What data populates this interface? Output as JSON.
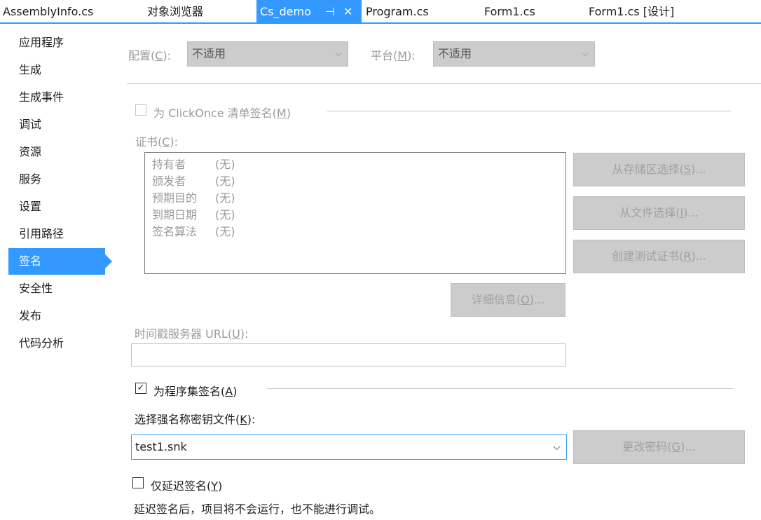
{
  "tabs": [
    {
      "label": "AssemblyInfo.cs"
    },
    {
      "label": "对象浏览器"
    },
    {
      "label": "Cs_demo",
      "pin": "⊣",
      "close": "✕"
    },
    {
      "label": "Program.cs"
    },
    {
      "label": "Form1.cs"
    },
    {
      "label": "Form1.cs [设计]"
    }
  ],
  "sidebar": {
    "items": [
      {
        "label": "应用程序"
      },
      {
        "label": "生成"
      },
      {
        "label": "生成事件"
      },
      {
        "label": "调试"
      },
      {
        "label": "资源"
      },
      {
        "label": "服务"
      },
      {
        "label": "设置"
      },
      {
        "label": "引用路径"
      },
      {
        "label": "签名",
        "active": true
      },
      {
        "label": "安全性"
      },
      {
        "label": "发布"
      },
      {
        "label": "代码分析"
      }
    ]
  },
  "config": {
    "label_pre": "配置(",
    "label_key": "C",
    "label_post": "):",
    "value": "不适用",
    "platform_pre": "平台(",
    "platform_key": "M",
    "platform_post": "):",
    "platform_value": "不适用"
  },
  "clickonce": {
    "checked": false,
    "label_pre": "为 ClickOnce 清单签名(",
    "label_key": "M",
    "label_post": ")"
  },
  "cert": {
    "label_pre": "证书(",
    "label_key": "C",
    "label_post": "):",
    "rows": [
      {
        "key": "持有者",
        "value": "(无)"
      },
      {
        "key": "颁发者",
        "value": "(无)"
      },
      {
        "key": "预期目的",
        "value": "(无)"
      },
      {
        "key": "到期日期",
        "value": "(无)"
      },
      {
        "key": "签名算法",
        "value": "(无)"
      }
    ],
    "btn_store_pre": "从存储区选择(",
    "btn_store_key": "S",
    "btn_store_post": ")...",
    "btn_file_pre": "从文件选择(",
    "btn_file_key": "I",
    "btn_file_post": ")...",
    "btn_test_pre": "创建测试证书(",
    "btn_test_key": "R",
    "btn_test_post": ")...",
    "btn_detail_pre": "详细信息(",
    "btn_detail_key": "O",
    "btn_detail_post": ")..."
  },
  "timestamp": {
    "label_pre": "时间戳服务器 URL(",
    "label_key": "U",
    "label_post": "):",
    "value": ""
  },
  "sign_assembly": {
    "checked": true,
    "check_glyph": "✓",
    "label_pre": "为程序集签名(",
    "label_key": "A",
    "label_post": ")"
  },
  "strong_name": {
    "label_pre": "选择强名称密钥文件(",
    "label_key": "K",
    "label_post": "):",
    "value": "test1.snk",
    "btn_pre": "更改密码(",
    "btn_key": "G",
    "btn_post": ")..."
  },
  "delay_sign": {
    "checked": false,
    "label_pre": "仅延迟签名(",
    "label_key": "Y",
    "label_post": ")",
    "note": "延迟签名后，项目将不会运行，也不能进行调试。"
  },
  "icons": {
    "chevron": "chevron-down-icon",
    "chevron_glyph": "⌵"
  },
  "colors": {
    "accent": "#3399ff",
    "disabled_text": "#9a9a9a",
    "disabled_fill": "#cccccc"
  }
}
